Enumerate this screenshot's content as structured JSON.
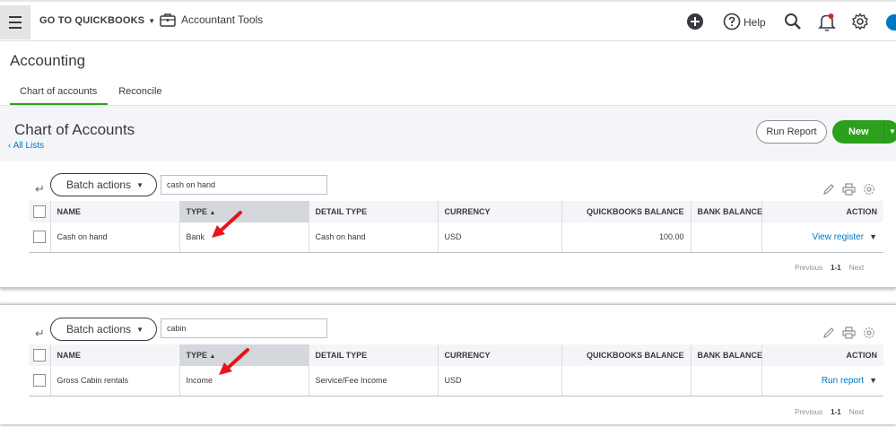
{
  "topbar": {
    "goto_label": "GO TO QUICKBOOKS",
    "accountant_tools_label": "Accountant Tools",
    "help_label": "Help"
  },
  "page": {
    "title": "Accounting",
    "tabs": [
      {
        "label": "Chart of accounts",
        "active": true
      },
      {
        "label": "Reconcile",
        "active": false
      }
    ]
  },
  "header": {
    "title": "Chart of Accounts",
    "all_lists": "All Lists",
    "run_report_label": "Run Report",
    "new_label": "New"
  },
  "colors": {
    "accent_green": "#2ca01c",
    "link_blue": "#0077c5",
    "annotation_red": "#e8141b"
  },
  "panels": [
    {
      "batch_label": "Batch actions",
      "search_value": "cash on hand",
      "columns": [
        "NAME",
        "TYPE",
        "DETAIL TYPE",
        "CURRENCY",
        "QUICKBOOKS BALANCE",
        "BANK BALANCE",
        "ACTION"
      ],
      "sort_arrow": "▲",
      "row": {
        "name": "Cash on hand",
        "type": "Bank",
        "detail_type": "Cash on hand",
        "currency": "USD",
        "qb_balance": "100.00",
        "bank_balance": "",
        "action": "View register"
      },
      "pager": {
        "previous": "Previous",
        "range": "1-1",
        "next": "Next"
      }
    },
    {
      "batch_label": "Batch actions",
      "search_value": "cabin",
      "columns": [
        "NAME",
        "TYPE",
        "DETAIL TYPE",
        "CURRENCY",
        "QUICKBOOKS BALANCE",
        "BANK BALANCE",
        "ACTION"
      ],
      "sort_arrow": "▲",
      "row": {
        "name": "Gross Cabin rentals",
        "type": "Income",
        "detail_type": "Service/Fee Income",
        "currency": "USD",
        "qb_balance": "",
        "bank_balance": "",
        "action": "Run report"
      },
      "pager": {
        "previous": "Previous",
        "range": "1-1",
        "next": "Next"
      }
    }
  ]
}
